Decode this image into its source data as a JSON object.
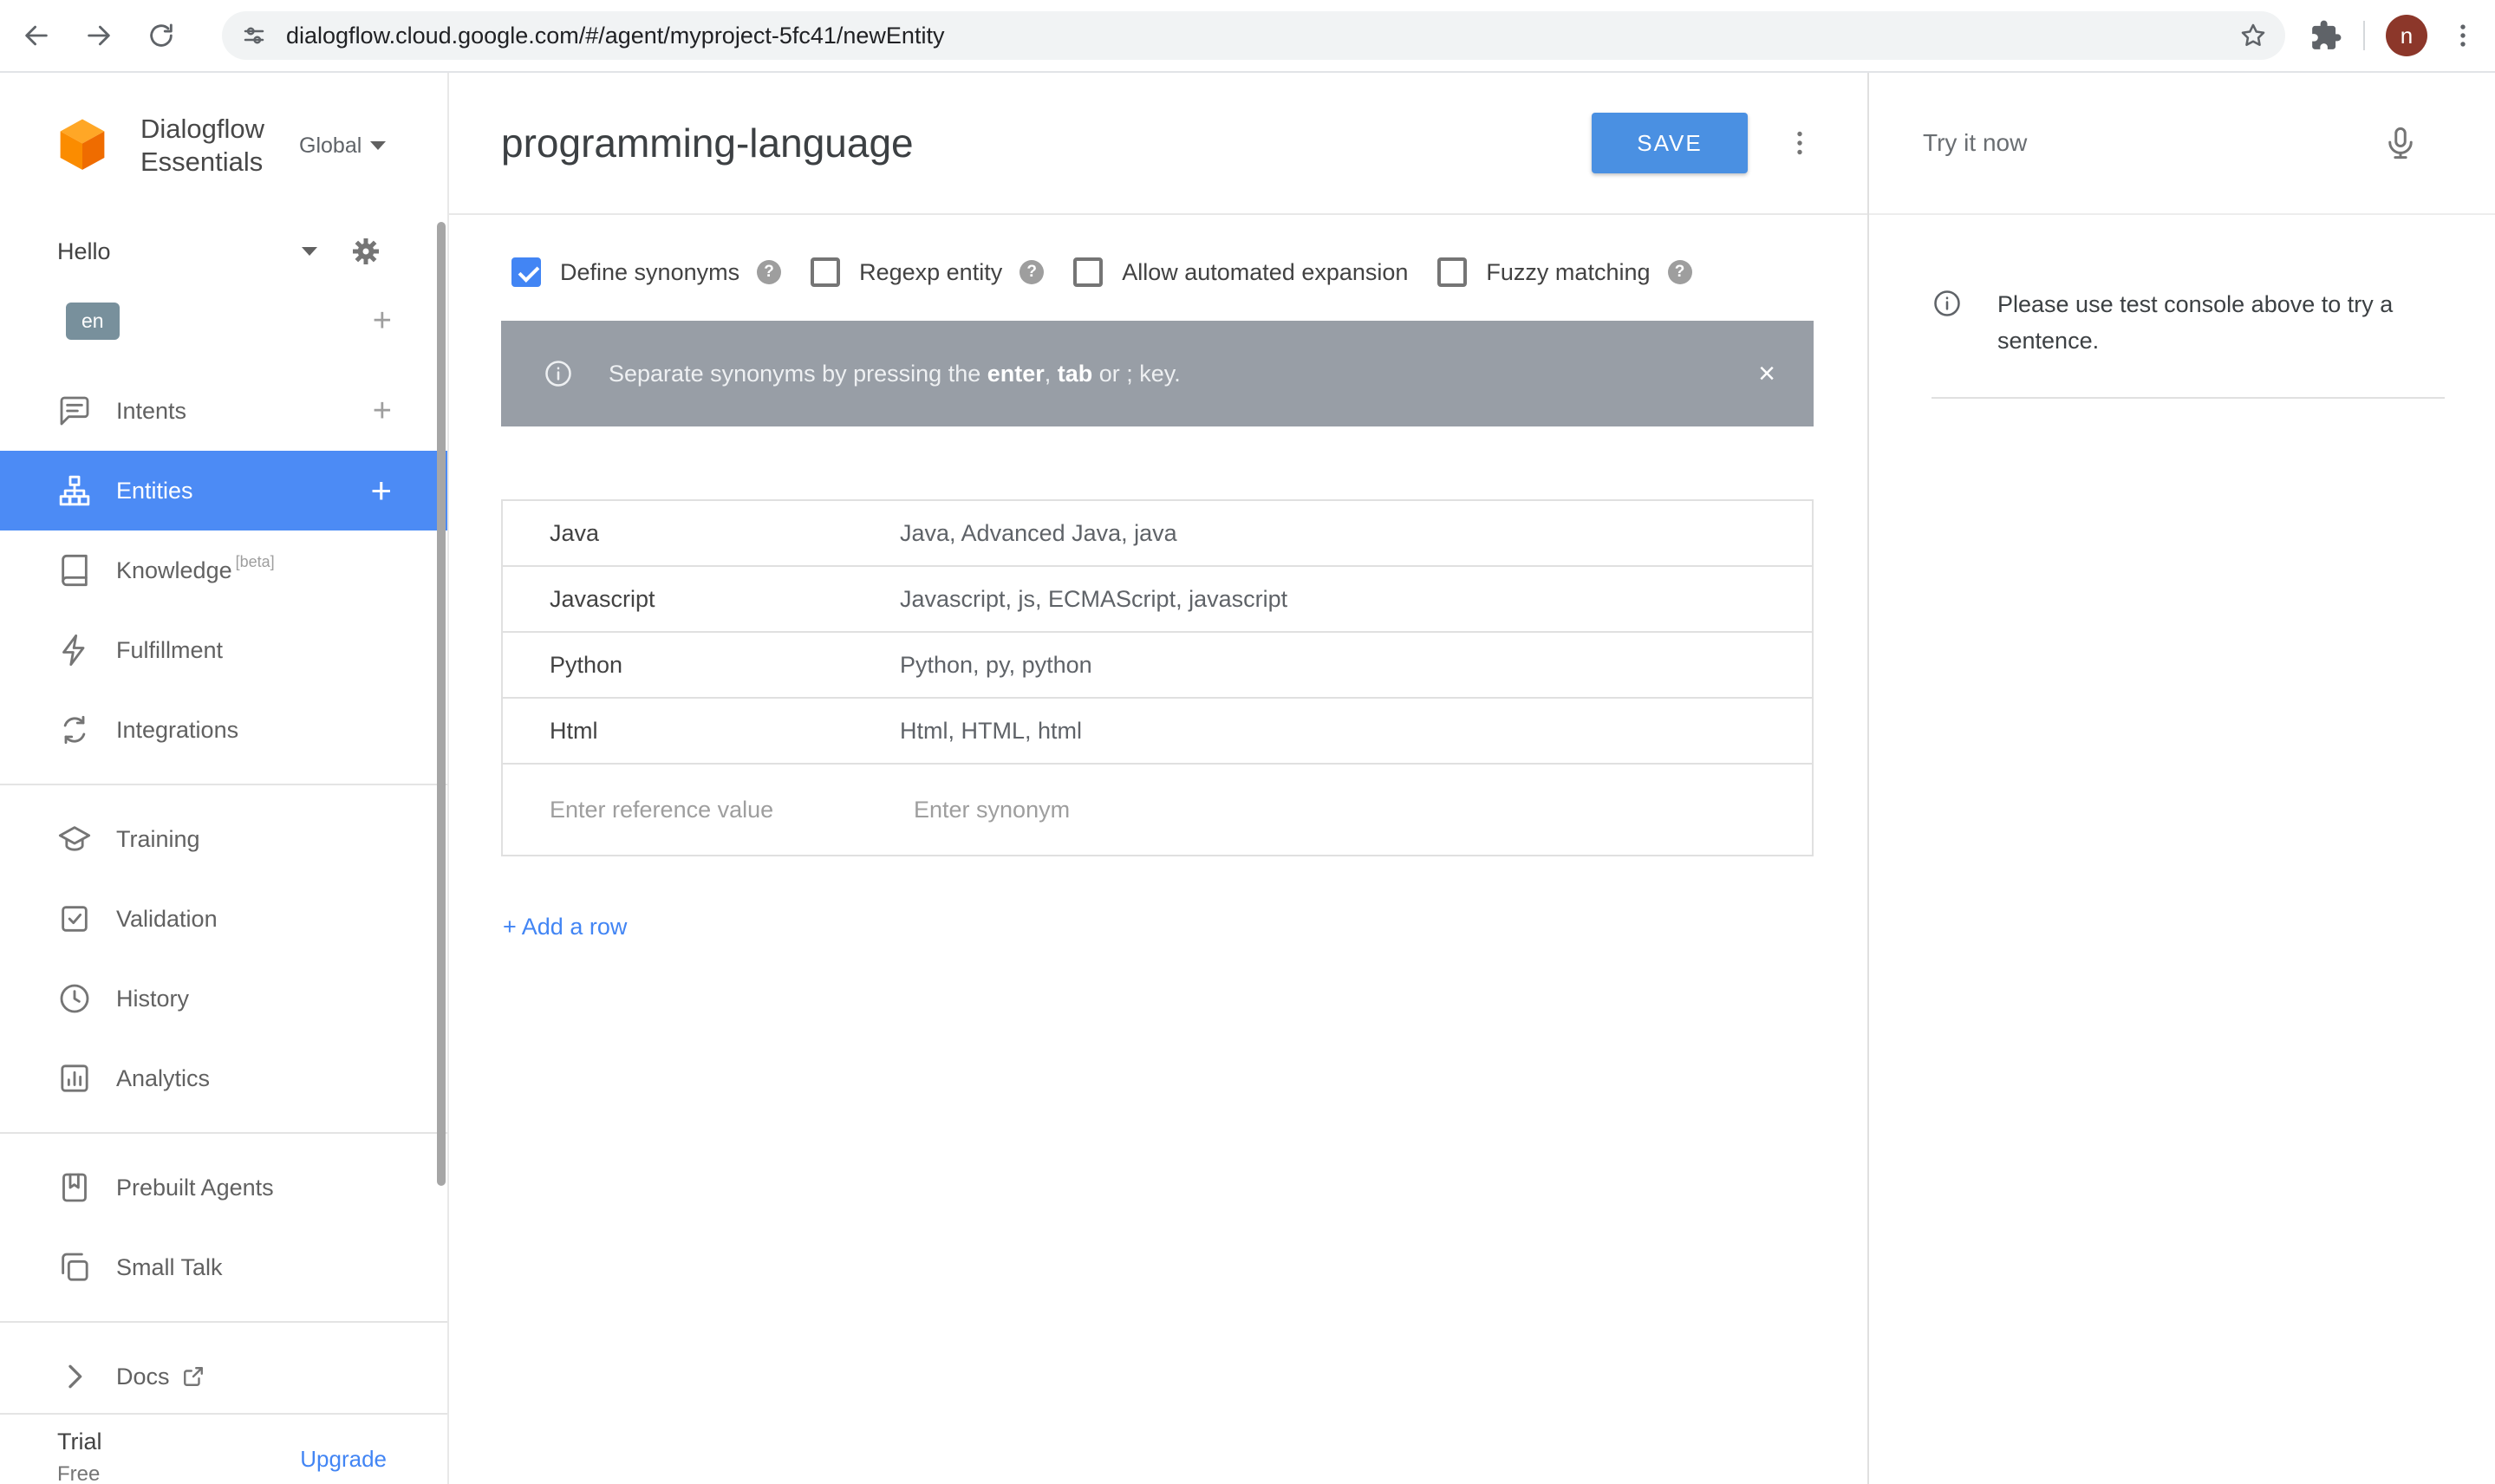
{
  "browser": {
    "url": "dialogflow.cloud.google.com/#/agent/myproject-5fc41/newEntity",
    "avatar_letter": "n"
  },
  "glyphs": {
    "plus": "+",
    "help": "?",
    "close": "×"
  },
  "sidebar": {
    "brand_line1": "Dialogflow",
    "brand_line2": "Essentials",
    "region": "Global",
    "agent_name": "Hello",
    "language": "en",
    "knowledge_badge": "[beta]",
    "items": [
      {
        "label": "Intents"
      },
      {
        "label": "Entities"
      },
      {
        "label": "Knowledge"
      },
      {
        "label": "Fulfillment"
      },
      {
        "label": "Integrations"
      },
      {
        "label": "Training"
      },
      {
        "label": "Validation"
      },
      {
        "label": "History"
      },
      {
        "label": "Analytics"
      },
      {
        "label": "Prebuilt Agents"
      },
      {
        "label": "Small Talk"
      },
      {
        "label": "Docs"
      }
    ],
    "plan": {
      "title": "Trial",
      "tier": "Free",
      "upgrade": "Upgrade"
    }
  },
  "header": {
    "title": "programming-language",
    "save": "SAVE"
  },
  "options": [
    {
      "label": "Define synonyms",
      "checked": true
    },
    {
      "label": "Regexp entity",
      "checked": false
    },
    {
      "label": "Allow automated expansion",
      "checked": false
    },
    {
      "label": "Fuzzy matching",
      "checked": false
    }
  ],
  "banner": {
    "pre": "Separate synonyms by pressing the ",
    "key1": "enter",
    "sep": ", ",
    "key2": "tab",
    "post": " or ; key."
  },
  "entity_table": {
    "rows": [
      {
        "reference": "Java",
        "synonyms": "Java, Advanced Java, java"
      },
      {
        "reference": "Javascript",
        "synonyms": "Javascript, js, ECMAScript, javascript"
      },
      {
        "reference": "Python",
        "synonyms": "Python, py, python"
      },
      {
        "reference": "Html",
        "synonyms": "Html, HTML, html"
      }
    ],
    "reference_placeholder": "Enter reference value",
    "synonym_placeholder": "Enter synonym"
  },
  "add_row": "+ Add a row",
  "test_panel": {
    "title": "Try it now",
    "message": "Please use test console above to try a sentence."
  },
  "colors": {
    "selected_blue": "#4c8bf5",
    "save_blue": "#4a90e2",
    "link_blue": "#4285f4",
    "lang_badge": "#78909c",
    "banner_gray": "#989ea6"
  }
}
